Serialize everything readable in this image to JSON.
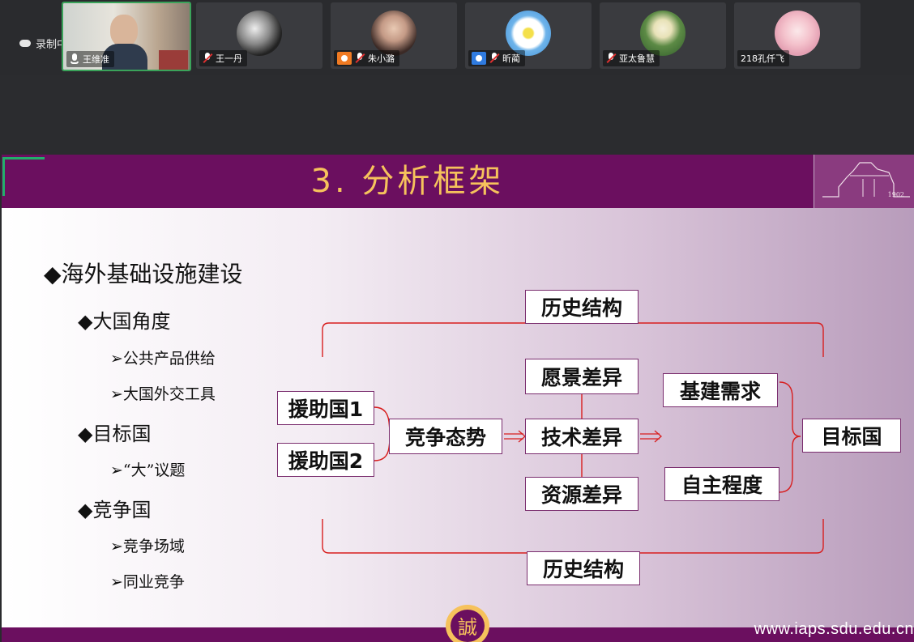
{
  "meeting": {
    "recording_label": "录制中",
    "participants": [
      {
        "name": "王维准",
        "mic": "on",
        "active": true,
        "badge": false
      },
      {
        "name": "王一丹",
        "mic": "muted",
        "active": false,
        "badge": false
      },
      {
        "name": "朱小潞",
        "mic": "muted",
        "active": false,
        "badge": true,
        "badge_color": "#f07a22"
      },
      {
        "name": "昕蔺",
        "mic": "muted",
        "active": false,
        "badge": true,
        "badge_color": "#2f7be0"
      },
      {
        "name": "亚太鲁慧",
        "mic": "muted",
        "active": false,
        "badge": false
      },
      {
        "name": "218孔仟飞",
        "mic": "none",
        "active": false,
        "badge": false
      }
    ]
  },
  "slide": {
    "title": "3. 分析框架",
    "logo_year": "1902",
    "bullets": {
      "main": "◆海外基础设施建设",
      "groups": [
        {
          "heading": "◆大国角度",
          "items": [
            "➢公共产品供给",
            "➢大国外交工具"
          ]
        },
        {
          "heading": "◆目标国",
          "items": [
            "➢“大”议题"
          ]
        },
        {
          "heading": "◆竞争国",
          "items": [
            "➢竞争场域",
            "➢同业竞争"
          ]
        }
      ]
    },
    "diagram": {
      "history_top": "历史结构",
      "history_bottom": "历史结构",
      "donor1": "援助国1",
      "donor2": "援助国2",
      "competition": "竞争态势",
      "vision": "愿景差异",
      "tech": "技术差异",
      "resource": "资源差异",
      "demand": "基建需求",
      "autonomy": "自主程度",
      "target": "目标国"
    },
    "url": "www.iaps.sdu.edu.cn"
  },
  "colors": {
    "purple": "#6b0f5f",
    "gold": "#f6c25c",
    "red": "#d81e1e",
    "green": "#21b06b"
  }
}
